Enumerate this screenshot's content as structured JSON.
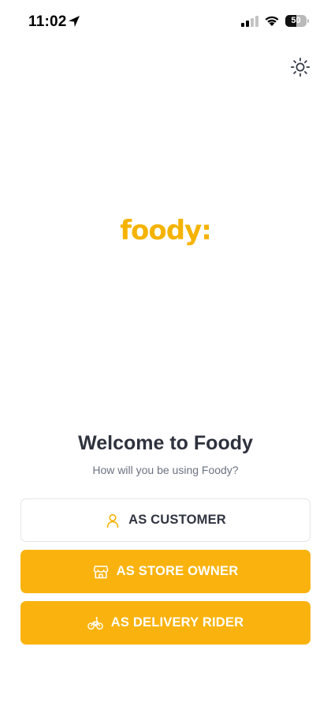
{
  "status_bar": {
    "time": "11:02",
    "battery_level": "50",
    "battery_fraction": 0.5
  },
  "icons": {
    "location": "location-arrow-icon",
    "signal": "cellular-signal-icon",
    "wifi": "wifi-icon",
    "theme": "sun-icon",
    "customer": "user-icon",
    "store": "storefront-icon",
    "rider": "bicycle-icon"
  },
  "logo": {
    "text": "foody:"
  },
  "welcome": {
    "title": "Welcome to Foody",
    "subtitle": "How will you be using Foody?"
  },
  "roles": {
    "customer_label": "AS CUSTOMER",
    "store_owner_label": "AS STORE OWNER",
    "delivery_rider_label": "AS DELIVERY RIDER"
  },
  "colors": {
    "brand": "#fab30e",
    "title_text": "#2e323d",
    "subtitle_text": "#6b7280"
  }
}
